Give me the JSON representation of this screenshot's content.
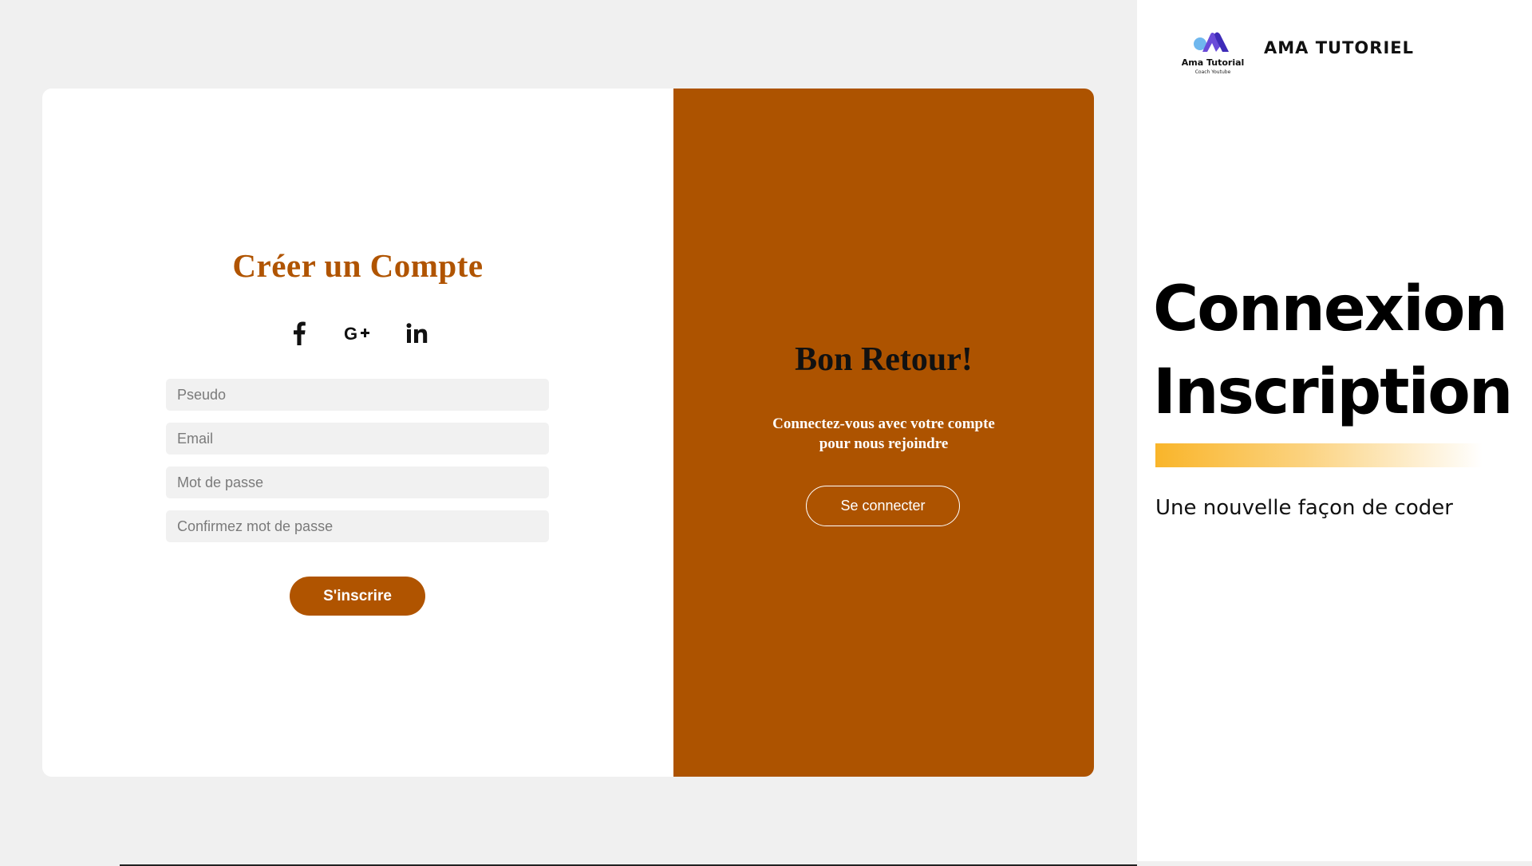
{
  "signup": {
    "title": "Créer un Compte",
    "social": [
      "facebook-icon",
      "google-plus-icon",
      "linkedin-icon"
    ],
    "fields": {
      "pseudo_placeholder": "Pseudo",
      "email_placeholder": "Email",
      "password_placeholder": "Mot de passe",
      "confirm_placeholder": "Confirmez mot de passe"
    },
    "submit_label": "S'inscrire"
  },
  "welcome": {
    "title": "Bon Retour!",
    "text_line1": "Connectez-vous avec votre compte",
    "text_line2": "pour nous rejoindre",
    "login_label": "Se connecter"
  },
  "brand": {
    "logo_name": "Ama Tutorial",
    "logo_sub": "Coach Youtube",
    "title": "AMA TUTORIEL",
    "headline_line1": "Connexion",
    "headline_line2": "Inscription",
    "tagline": "Une nouvelle façon de coder"
  },
  "colors": {
    "accent": "#ad5300",
    "title_accent": "#b05400",
    "stage_bg": "#f0f0f0",
    "field_bg": "#f1f1f1",
    "gradient_start": "#f9b52a"
  }
}
